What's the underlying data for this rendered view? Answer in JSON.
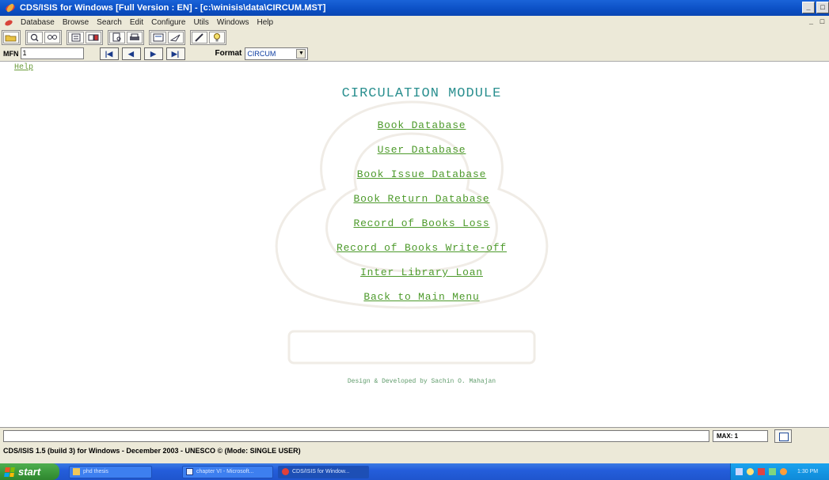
{
  "window": {
    "title": "CDS/ISIS for Windows [Full Version : EN] - [c:\\winisis\\data\\CIRCUM.MST]",
    "controls": [
      "_",
      "□",
      "×"
    ]
  },
  "menubar": {
    "items": [
      "Database",
      "Browse",
      "Search",
      "Edit",
      "Configure",
      "Utils",
      "Windows",
      "Help"
    ]
  },
  "toolbar": {
    "groups": [
      [
        "open-database-icon"
      ],
      [
        "search-icon",
        "find-icon"
      ],
      [
        "browse-icon",
        "edit-record-icon"
      ],
      [
        "print-preview-icon",
        "print-icon"
      ],
      [
        "hit-list-icon",
        "send-icon"
      ],
      [
        "pencil-icon",
        "help-bulb-icon"
      ]
    ]
  },
  "navigation": {
    "mfn_label": "MFN",
    "mfn_value": "1",
    "buttons": [
      "|◀",
      "◀",
      "▶",
      "▶|"
    ],
    "format_label": "Format",
    "format_value": "CIRCUM"
  },
  "main": {
    "help_link": "Help",
    "module_title": "CIRCULATION MODULE",
    "links": [
      "Book Database",
      "User Database",
      "Book Issue Database",
      "Book Return Database",
      "Record of Books Loss",
      "Record of Books Write-off",
      "Inter Library Loan",
      "Back to Main Menu"
    ],
    "credit": "Design & Developed by Sachin O. Mahajan"
  },
  "commandbar": {
    "max_label": "MAX: 1"
  },
  "statusbar": {
    "text": "CDS/ISIS 1.5 (build 3) for Windows - December 2003 - UNESCO © (Mode: SINGLE USER)"
  },
  "taskbar": {
    "start_label": "start",
    "tasks": [
      "phd thesis",
      "chapter VI - Microsoft...",
      "CDS/ISIS for Window..."
    ],
    "clock": "1:30 PM",
    "colors": {
      "bar": "#245edb",
      "start": "#3a973a",
      "tray": "#0f8ad9"
    }
  }
}
